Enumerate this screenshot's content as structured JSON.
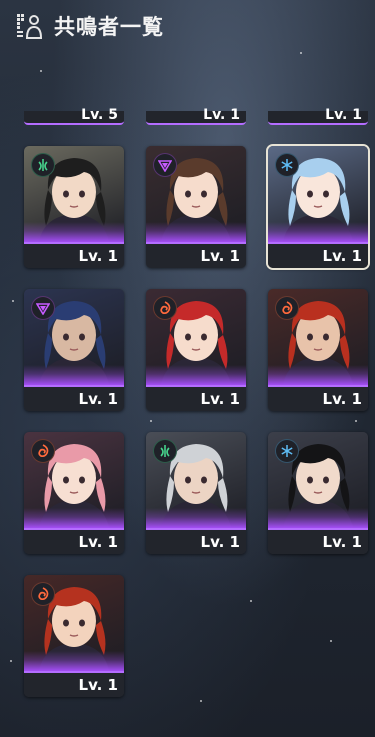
{
  "header": {
    "title": "共鳴者一覧",
    "icon": "resonator-list-icon"
  },
  "partial_row": [
    {
      "level": "Lv. 5"
    },
    {
      "level": "Lv. 1"
    },
    {
      "level": "Lv. 1"
    }
  ],
  "cards": [
    {
      "level": "Lv. 1",
      "element": "aero",
      "hair": "#1e1e1e",
      "skin": "#f2d9c6",
      "bg": "#6b6a5f",
      "selected": false
    },
    {
      "level": "Lv. 1",
      "element": "havoc",
      "hair": "#5a3b2c",
      "skin": "#f6dccc",
      "bg": "#3a2d30",
      "selected": false
    },
    {
      "level": "Lv. 1",
      "element": "glacio",
      "hair": "#a8cfee",
      "skin": "#f9e6db",
      "bg": "#5b6a86",
      "selected": true
    },
    {
      "level": "Lv. 1",
      "element": "havoc",
      "hair": "#2a3d73",
      "skin": "#d8b8a2",
      "bg": "#2c3450",
      "selected": false
    },
    {
      "level": "Lv. 1",
      "element": "fusion",
      "hair": "#c52a2a",
      "skin": "#f6dccc",
      "bg": "#3b2a33",
      "selected": false
    },
    {
      "level": "Lv. 1",
      "element": "fusion",
      "hair": "#b9301f",
      "skin": "#e8c3aa",
      "bg": "#4a2a28",
      "selected": false
    },
    {
      "level": "Lv. 1",
      "element": "fusion",
      "hair": "#e99aa8",
      "skin": "#f7dfd2",
      "bg": "#4a3340",
      "selected": false
    },
    {
      "level": "Lv. 1",
      "element": "aero",
      "hair": "#cfd2d6",
      "skin": "#ecd4c4",
      "bg": "#4a4e57",
      "selected": false
    },
    {
      "level": "Lv. 1",
      "element": "glacio",
      "hair": "#141416",
      "skin": "#f1dacb",
      "bg": "#3c3f4a",
      "selected": false
    },
    {
      "level": "Lv. 1",
      "element": "fusion",
      "hair": "#b5321f",
      "skin": "#f3d3bd",
      "bg": "#462827",
      "selected": false
    }
  ],
  "element_colors": {
    "aero": "#47d38c",
    "havoc": "#c65bff",
    "glacio": "#5fbdf5",
    "fusion": "#ff6a3d"
  }
}
